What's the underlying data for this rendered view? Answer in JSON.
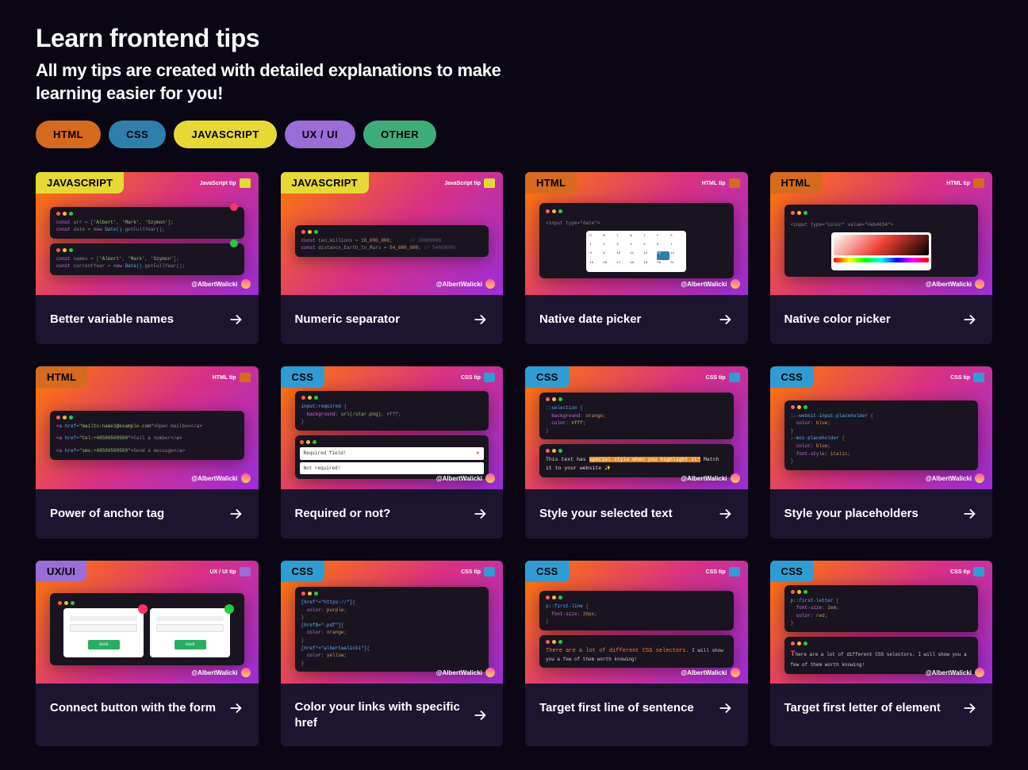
{
  "heading": {
    "title": "Learn frontend tips",
    "subtitle": "All my tips are created with detailed explanations to make learning easier for you!"
  },
  "filters": [
    {
      "label": "HTML",
      "class": "filter-html"
    },
    {
      "label": "CSS",
      "class": "filter-css"
    },
    {
      "label": "JAVASCRIPT",
      "class": "filter-js"
    },
    {
      "label": "UX / UI",
      "class": "filter-ux"
    },
    {
      "label": "OTHER",
      "class": "filter-other"
    }
  ],
  "handle": "@AlbertWalicki",
  "tips": {
    "t0": {
      "tag": "JAVASCRIPT",
      "tagClass": "tag-javascript",
      "tipLabel": "JavaScript tip",
      "title": "Better variable names"
    },
    "t1": {
      "tag": "JAVASCRIPT",
      "tagClass": "tag-javascript",
      "tipLabel": "JavaScript tip",
      "title": "Numeric separator"
    },
    "t2": {
      "tag": "HTML",
      "tagClass": "tag-html",
      "tipLabel": "HTML tip",
      "title": "Native date picker"
    },
    "t3": {
      "tag": "HTML",
      "tagClass": "tag-html",
      "tipLabel": "HTML tip",
      "title": "Native color picker"
    },
    "t4": {
      "tag": "HTML",
      "tagClass": "tag-html",
      "tipLabel": "HTML tip",
      "title": "Power of anchor tag"
    },
    "t5": {
      "tag": "CSS",
      "tagClass": "tag-css",
      "tipLabel": "CSS tip",
      "title": "Required or not?"
    },
    "t6": {
      "tag": "CSS",
      "tagClass": "tag-css",
      "tipLabel": "CSS tip",
      "title": "Style your selected text"
    },
    "t7": {
      "tag": "CSS",
      "tagClass": "tag-css",
      "tipLabel": "CSS tip",
      "title": "Style your placeholders"
    },
    "t8": {
      "tag": "UX/UI",
      "tagClass": "tag-ux",
      "tipLabel": "UX / UI tip",
      "title": "Connect button with the form"
    },
    "t9": {
      "tag": "CSS",
      "tagClass": "tag-css",
      "tipLabel": "CSS tip",
      "title": "Color your links with specific href"
    },
    "t10": {
      "tag": "CSS",
      "tagClass": "tag-css",
      "tipLabel": "CSS tip",
      "title": "Target first line of sentence"
    },
    "t11": {
      "tag": "CSS",
      "tagClass": "tag-css",
      "tipLabel": "CSS tip",
      "title": "Target first letter of element"
    }
  },
  "previews": {
    "pAnchor1": "<a href=\"mailto:name1@example.com\">Open mailbox</a>",
    "pAnchor2": "<a href=\"tel:+48500500500\">Call a number</a>",
    "pAnchor3": "<a href=\"sms:+48500500500\">Send a message</a>",
    "pNum1": "const ten_millions = 10_000_000;      // 10000000",
    "pNum2": "const distance_Earth_to_Mars = 54_600_000; // 54600000",
    "pSel1": "::selection {",
    "pSel2": "  background: orange;",
    "pSel3": "  color: #fff;",
    "pSelTxt": "This text has special style when you highlight it! Match it to your website ✨",
    "pReq1": "input:required {",
    "pReq2": "  background: url(/star.png), #fff;",
    "pReqField1": "Required field!",
    "pReqField2": "Not required!",
    "pPh1": "::-webkit-input-placeholder {",
    "pPh2": "  color: blue;",
    "pPh3": ":-moz-placeholder {",
    "pPh4": "  font-style: italic;",
    "pLinks1": "[href*=\"https://\"]{",
    "pLinks2": "  color: purple;",
    "pLinks3": "[href$=\".pdf\"]{",
    "pLinks4": "  color: orange;",
    "pLinks5": "[href*=\"albertwalicki\"]{",
    "pLinks6": "  color: yellow;",
    "pFLine1": "p::first-line {",
    "pFLine2": "  font-size: 20px;",
    "pFLineTxt": "There are a lot of different CSS selectors. I will show you a few of them worth knowing!",
    "pFLet1": "p::first-letter {",
    "pFLet2": "  font-size: 2em;",
    "pFLet3": "  color: red;",
    "pFLetTxt": "There are a lot of different CSS selectors. I will show you a few of them worth knowing!",
    "pDate": "<input type=\"date\">",
    "pColor": "<input type=\"color\" value=\"#eb4034\">",
    "pVar1": "const arr = ['Albert', 'Mark', 'Szymon'];",
    "pVar2": "const date = new Date().getFullYear();",
    "pVar3": "const names = ['Albert', 'Mark', 'Szymon'];",
    "pVar4": "const currentYear = new Date().getFullYear();",
    "pFormBtn": "SAVE"
  }
}
